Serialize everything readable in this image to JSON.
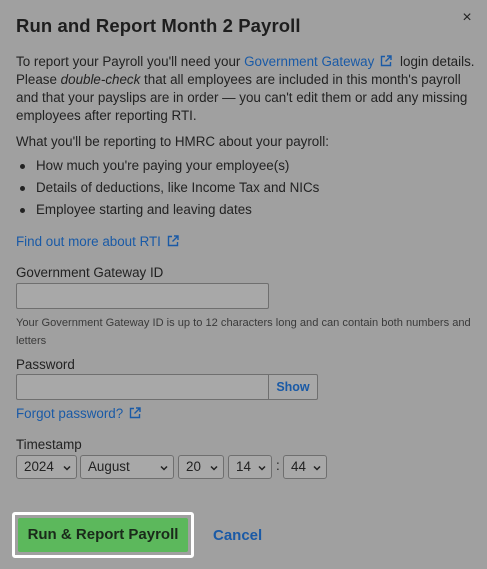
{
  "dialog": {
    "title": "Run and Report Month 2 Payroll",
    "close_label": "×"
  },
  "intro": {
    "part1": "To report your Payroll you'll need your ",
    "gateway_link": "Government Gateway",
    "part2": " login details. Please ",
    "emphasis": "double-check",
    "part3": " that all employees are included in this month's payroll and that your payslips are in order — you can't edit them or add any missing employees after reporting RTI."
  },
  "reporting": {
    "heading": "What you'll be reporting to HMRC about your payroll:",
    "bullets": [
      "How much you're paying your employee(s)",
      "Details of deductions, like Income Tax and NICs",
      "Employee starting and leaving dates"
    ]
  },
  "rti_link": "Find out more about RTI",
  "gateway_id": {
    "label": "Government Gateway ID",
    "value": "",
    "hint": "Your Government Gateway ID is up to 12 characters long and can contain both numbers and letters"
  },
  "password": {
    "label": "Password",
    "value": "",
    "show_label": "Show",
    "forgot_link": "Forgot password?"
  },
  "timestamp": {
    "label": "Timestamp",
    "year": "2024",
    "month": "August",
    "day": "20",
    "hour": "14",
    "minute": "44",
    "separator": ":"
  },
  "actions": {
    "primary": "Run & Report Payroll",
    "cancel": "Cancel"
  },
  "colors": {
    "overlay_bg": "#a0a0a0",
    "link": "#1a5aa6",
    "primary_button": "#5cb85c"
  },
  "icons": {
    "external": "external-link-icon",
    "close": "close-icon",
    "chevron": "chevron-down-icon"
  }
}
